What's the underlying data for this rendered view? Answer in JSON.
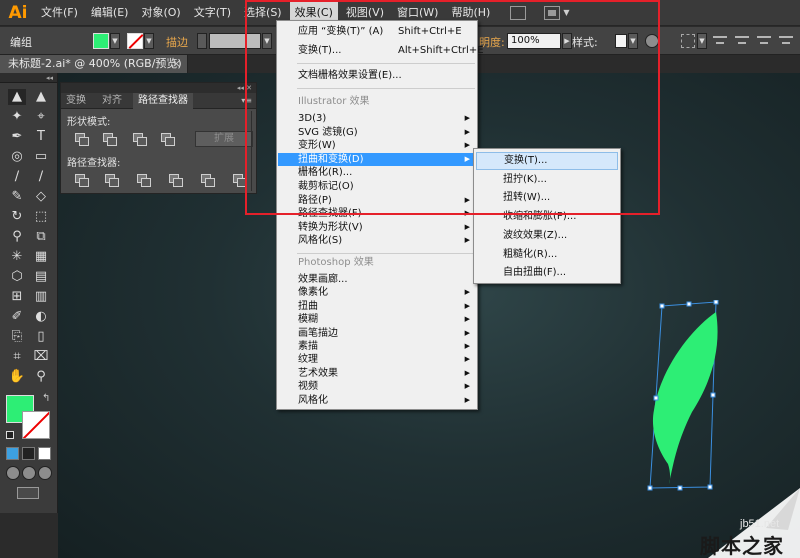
{
  "app": {
    "logo": "Ai"
  },
  "menubar": {
    "items": [
      "文件(F)",
      "编辑(E)",
      "对象(O)",
      "文字(T)",
      "选择(S)",
      "效果(C)",
      "视图(V)",
      "窗口(W)",
      "帮助(H)"
    ],
    "active_index": 5
  },
  "controlbar": {
    "selection_label": "编组",
    "stroke_label": "描边",
    "opacity_label": "明度:",
    "opacity_value": "100%",
    "style_label": "样式:",
    "fill_color": "#2dee75"
  },
  "document": {
    "tab_title": "未标题-2.ai* @ 400% (RGB/预览)",
    "close": "×"
  },
  "pathfinder_panel": {
    "tabs": [
      "变换",
      "对齐",
      "路径查找器"
    ],
    "active_tab": 2,
    "shape_modes_label": "形状模式:",
    "pathfinders_label": "路径查找器:",
    "expand_label": "扩展"
  },
  "effect_menu": {
    "apply_last": {
      "label": "应用 “变换(T)” (A)",
      "shortcut": "Shift+Ctrl+E"
    },
    "last_effect": {
      "label": "变换(T)...",
      "shortcut": "Alt+Shift+Ctrl+E"
    },
    "raster_settings": "文档栅格效果设置(E)...",
    "illustrator_header": "Illustrator 效果",
    "illustrator_items": [
      {
        "label": "3D(3)",
        "submenu": true
      },
      {
        "label": "SVG 滤镜(G)",
        "submenu": true
      },
      {
        "label": "变形(W)",
        "submenu": true
      },
      {
        "label": "扭曲和变换(D)",
        "submenu": true,
        "highlighted": true
      },
      {
        "label": "栅格化(R)...",
        "submenu": false
      },
      {
        "label": "裁剪标记(O)",
        "submenu": false
      },
      {
        "label": "路径(P)",
        "submenu": true
      },
      {
        "label": "路径查找器(F)",
        "submenu": true
      },
      {
        "label": "转换为形状(V)",
        "submenu": true
      },
      {
        "label": "风格化(S)",
        "submenu": true
      }
    ],
    "photoshop_header": "Photoshop 效果",
    "photoshop_items": [
      {
        "label": "效果画廊...",
        "submenu": false
      },
      {
        "label": "像素化",
        "submenu": true
      },
      {
        "label": "扭曲",
        "submenu": true
      },
      {
        "label": "模糊",
        "submenu": true
      },
      {
        "label": "画笔描边",
        "submenu": true
      },
      {
        "label": "素描",
        "submenu": true
      },
      {
        "label": "纹理",
        "submenu": true
      },
      {
        "label": "艺术效果",
        "submenu": true
      },
      {
        "label": "视频",
        "submenu": true
      },
      {
        "label": "风格化",
        "submenu": true
      }
    ]
  },
  "distort_submenu": {
    "items": [
      "变换(T)...",
      "扭拧(K)...",
      "扭转(W)...",
      "收缩和膨胀(P)...",
      "波纹效果(Z)...",
      "粗糙化(R)...",
      "自由扭曲(F)..."
    ],
    "highlighted_index": 0
  },
  "tools": {
    "fill_color": "#2dee75",
    "stroke_color": "#ffffff",
    "glyphs": [
      [
        "▲",
        "▲"
      ],
      [
        "✦",
        "⌖"
      ],
      [
        "✒",
        "T"
      ],
      [
        "◎",
        "▭"
      ],
      [
        "∕",
        "∕"
      ],
      [
        "✎",
        "◇"
      ],
      [
        "↻",
        "⬚"
      ],
      [
        "⚲",
        "⧉"
      ],
      [
        "✳",
        "▦"
      ],
      [
        "⬡",
        "▤"
      ],
      [
        "⊞",
        "▥"
      ],
      [
        "✐",
        "◐"
      ],
      [
        "⎘",
        "▯"
      ],
      [
        "⌗",
        "⌧"
      ],
      [
        "✋",
        "⚲"
      ]
    ]
  },
  "artwork": {
    "leaf_color": "#2dee75",
    "annotation_color": "#e5202a"
  },
  "watermark": {
    "url": "jb51.net",
    "text": "脚本之家"
  }
}
